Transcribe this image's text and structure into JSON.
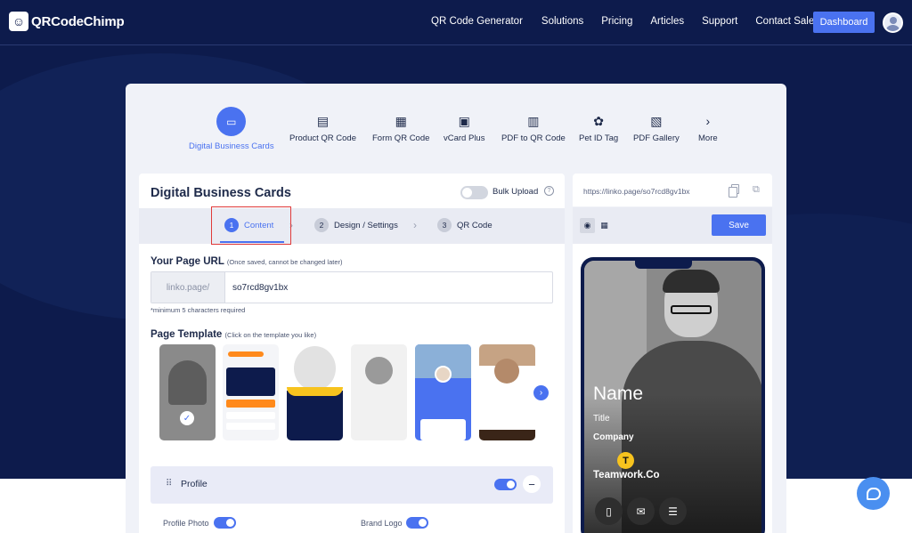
{
  "nav": {
    "logo_text": "QRCodeChimp",
    "links": [
      "QR Code Generator",
      "Solutions",
      "Pricing",
      "Articles",
      "Support",
      "Contact Sales"
    ],
    "dashboard_label": "Dashboard"
  },
  "types": [
    {
      "label": "Digital Business Cards",
      "icon": "business-card-icon",
      "active": true
    },
    {
      "label": "Product QR Code",
      "icon": "product-icon"
    },
    {
      "label": "Form QR Code",
      "icon": "form-icon"
    },
    {
      "label": "vCard Plus",
      "icon": "vcard-icon"
    },
    {
      "label": "PDF to QR Code",
      "icon": "pdf-icon"
    },
    {
      "label": "Pet ID Tag",
      "icon": "pet-icon"
    },
    {
      "label": "PDF Gallery",
      "icon": "gallery-icon"
    },
    {
      "label": "More",
      "icon": "chevron-right-icon"
    }
  ],
  "editor": {
    "title": "Digital Business Cards",
    "bulk_upload_label": "Bulk Upload",
    "steps": [
      {
        "num": "1",
        "label": "Content"
      },
      {
        "num": "2",
        "label": "Design / Settings"
      },
      {
        "num": "3",
        "label": "QR Code"
      }
    ],
    "url_section": {
      "title": "Your Page URL",
      "hint": "(Once saved, cannot be changed later)",
      "prefix": "linko.page/",
      "value": "so7rcd8gv1bx",
      "note": "*minimum 5 characters required"
    },
    "template_section": {
      "title": "Page Template",
      "hint": "(Click on the template you like)"
    },
    "profile_section": {
      "label": "Profile",
      "profile_photo_label": "Profile Photo",
      "brand_logo_label": "Brand Logo"
    }
  },
  "preview": {
    "url": "https://linko.page/so7rcd8gv1bx",
    "save_label": "Save",
    "name": "Name",
    "title": "Title",
    "company": "Company",
    "brand": "Teamwork.Co",
    "logo_letter": "T"
  },
  "colors": {
    "accent": "#4a72f0",
    "navy": "#0d1b4c",
    "highlight": "#e03a3a"
  }
}
